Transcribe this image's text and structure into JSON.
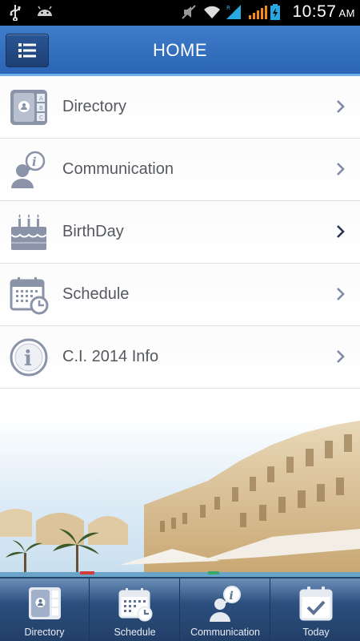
{
  "status_bar": {
    "time": "10:57",
    "ampm": "AM",
    "icons": [
      "usb-icon",
      "android-icon",
      "mute-icon",
      "wifi-icon",
      "signal-icon",
      "signal-icon",
      "battery-icon"
    ]
  },
  "header": {
    "title": "HOME",
    "menu_icon": "menu-list-icon"
  },
  "menu_items": [
    {
      "label": "Directory",
      "icon": "directory-icon"
    },
    {
      "label": "Communication",
      "icon": "communication-icon"
    },
    {
      "label": "BirthDay",
      "icon": "birthday-cake-icon"
    },
    {
      "label": "Schedule",
      "icon": "schedule-icon"
    },
    {
      "label": "C.I. 2014 Info",
      "icon": "info-icon"
    }
  ],
  "tabs": [
    {
      "label": "Directory",
      "icon": "directory-icon"
    },
    {
      "label": "Schedule",
      "icon": "schedule-icon"
    },
    {
      "label": "Communication",
      "icon": "communication-icon"
    },
    {
      "label": "Today",
      "icon": "today-check-icon"
    }
  ],
  "colors": {
    "header": "#2f6cbb",
    "accent_line": "#6fb0e8",
    "icon_gray": "#8a93a8",
    "tabbar": "#2c4f7e"
  }
}
